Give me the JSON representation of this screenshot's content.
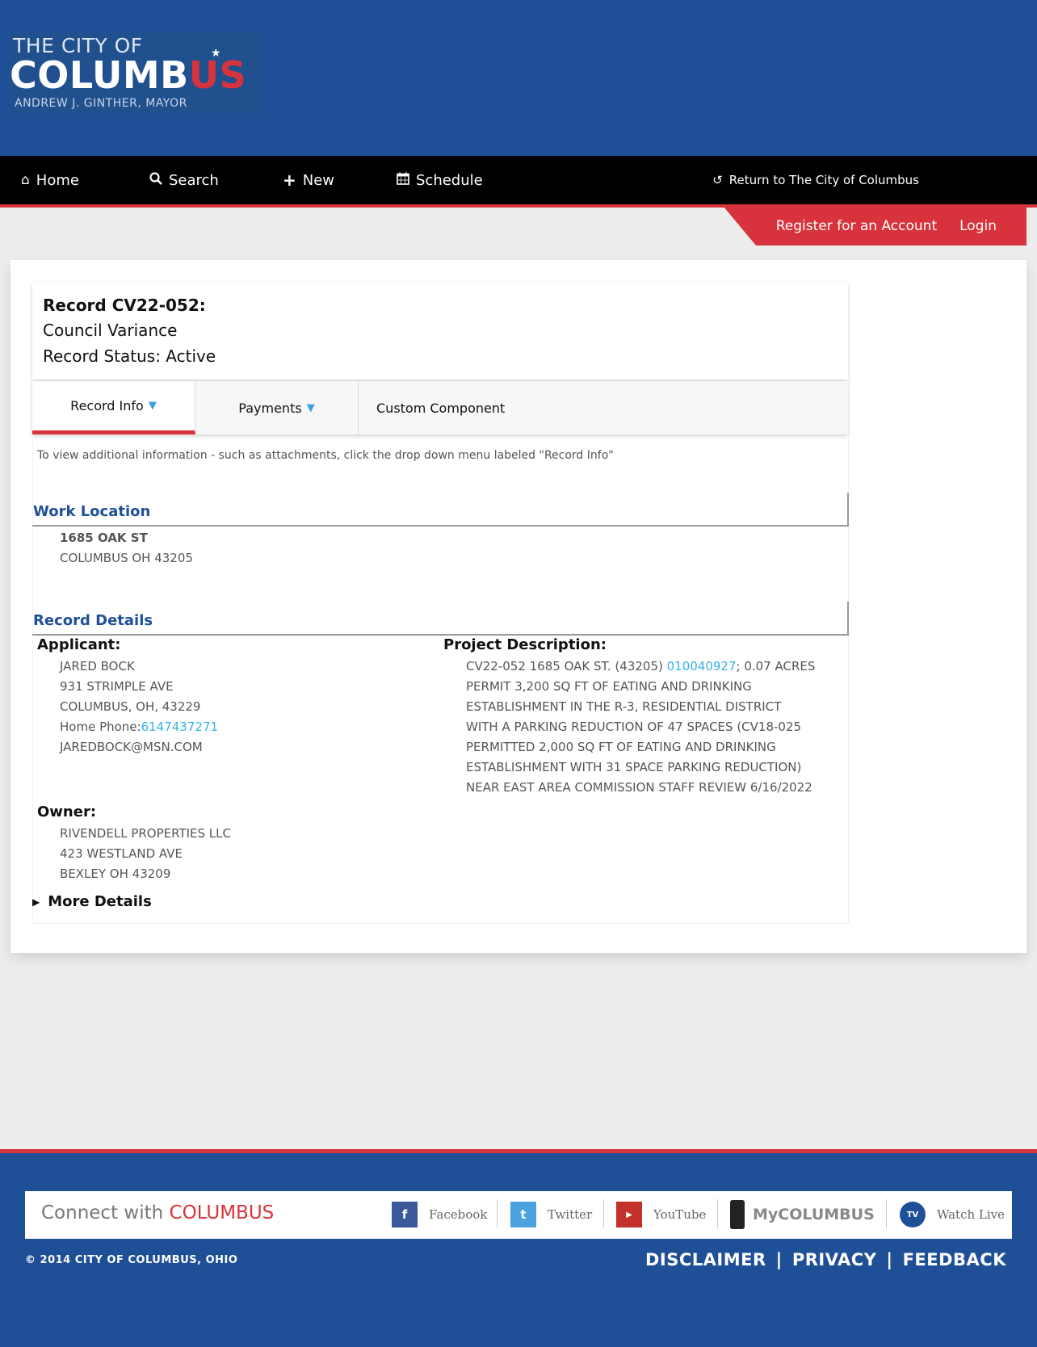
{
  "header": {
    "logo": {
      "line1": "THE CITY OF",
      "line2_main": "COLUMB",
      "line2_accent": "US",
      "line3": "ANDREW J. GINTHER, MAYOR"
    }
  },
  "nav": {
    "items": [
      {
        "label": "Home",
        "icon": "home-icon"
      },
      {
        "label": "Search",
        "icon": "search-icon"
      },
      {
        "label": "New",
        "icon": "plus-icon"
      },
      {
        "label": "Schedule",
        "icon": "calendar-icon"
      }
    ],
    "return_label": "Return to The City of Columbus"
  },
  "account": {
    "register_label": "Register for an Account",
    "login_label": "Login"
  },
  "record": {
    "title": "Record CV22-052:",
    "type": "Council Variance",
    "status": "Record Status: Active"
  },
  "tabs": [
    {
      "label": "Record Info",
      "active": true
    },
    {
      "label": "Payments",
      "active": false
    },
    {
      "label": "Custom Component",
      "active": false
    }
  ],
  "info_text": "To view additional information - such as attachments, click the drop down menu labeled \"Record Info\"",
  "work_location": {
    "heading": "Work Location",
    "line1": "1685 OAK ST",
    "line2": "COLUMBUS OH 43205"
  },
  "record_details": {
    "heading": "Record Details",
    "applicant": {
      "label": "Applicant:",
      "name": "JARED BOCK",
      "address1": "931 STRIMPLE AVE",
      "address2": "COLUMBUS, OH, 43229",
      "phone_label": "Home Phone:",
      "phone": "6147437271",
      "email": "JAREDBOCK@MSN.COM"
    },
    "owner": {
      "label": "Owner:",
      "name": "RIVENDELL PROPERTIES LLC",
      "address1": "423 WESTLAND AVE",
      "address2": "BEXLEY OH 43209"
    },
    "project": {
      "label": "Project Description:",
      "line1_prefix": "CV22-052 1685 OAK ST. (43205) ",
      "parcel_link": "010040927",
      "line1_suffix": "; 0.07 ACRES",
      "line2": "PERMIT 3,200 SQ FT OF EATING AND DRINKING",
      "line3": "ESTABLISHMENT IN THE R-3, RESIDENTIAL DISTRICT",
      "line4": "WITH A PARKING REDUCTION OF 47 SPACES (CV18-025",
      "line5": "PERMITTED 2,000 SQ FT OF EATING AND DRINKING",
      "line6": "ESTABLISHMENT WITH 31 SPACE PARKING REDUCTION)",
      "line7": "NEAR EAST AREA COMMISSION STAFF REVIEW 6/16/2022"
    },
    "more_details": "More Details"
  },
  "footer": {
    "connect_prefix": "Connect with ",
    "connect_accent": "COLUMBUS",
    "social": [
      {
        "label": "Facebook",
        "icon": "facebook-icon"
      },
      {
        "label": "Twitter",
        "icon": "twitter-icon"
      },
      {
        "label": "YouTube",
        "icon": "youtube-icon"
      },
      {
        "label": "MyCOLUMBUS",
        "icon": "phone-icon"
      },
      {
        "label": "Watch Live",
        "icon": "tv-icon"
      }
    ],
    "copyright": "© 2014 CITY OF COLUMBUS, OHIO",
    "links": [
      "DISCLAIMER",
      "PRIVACY",
      "FEEDBACK"
    ]
  },
  "colors": {
    "brand_blue": "#1f5097",
    "brand_red": "#d8333c",
    "link": "#35b1e8"
  }
}
